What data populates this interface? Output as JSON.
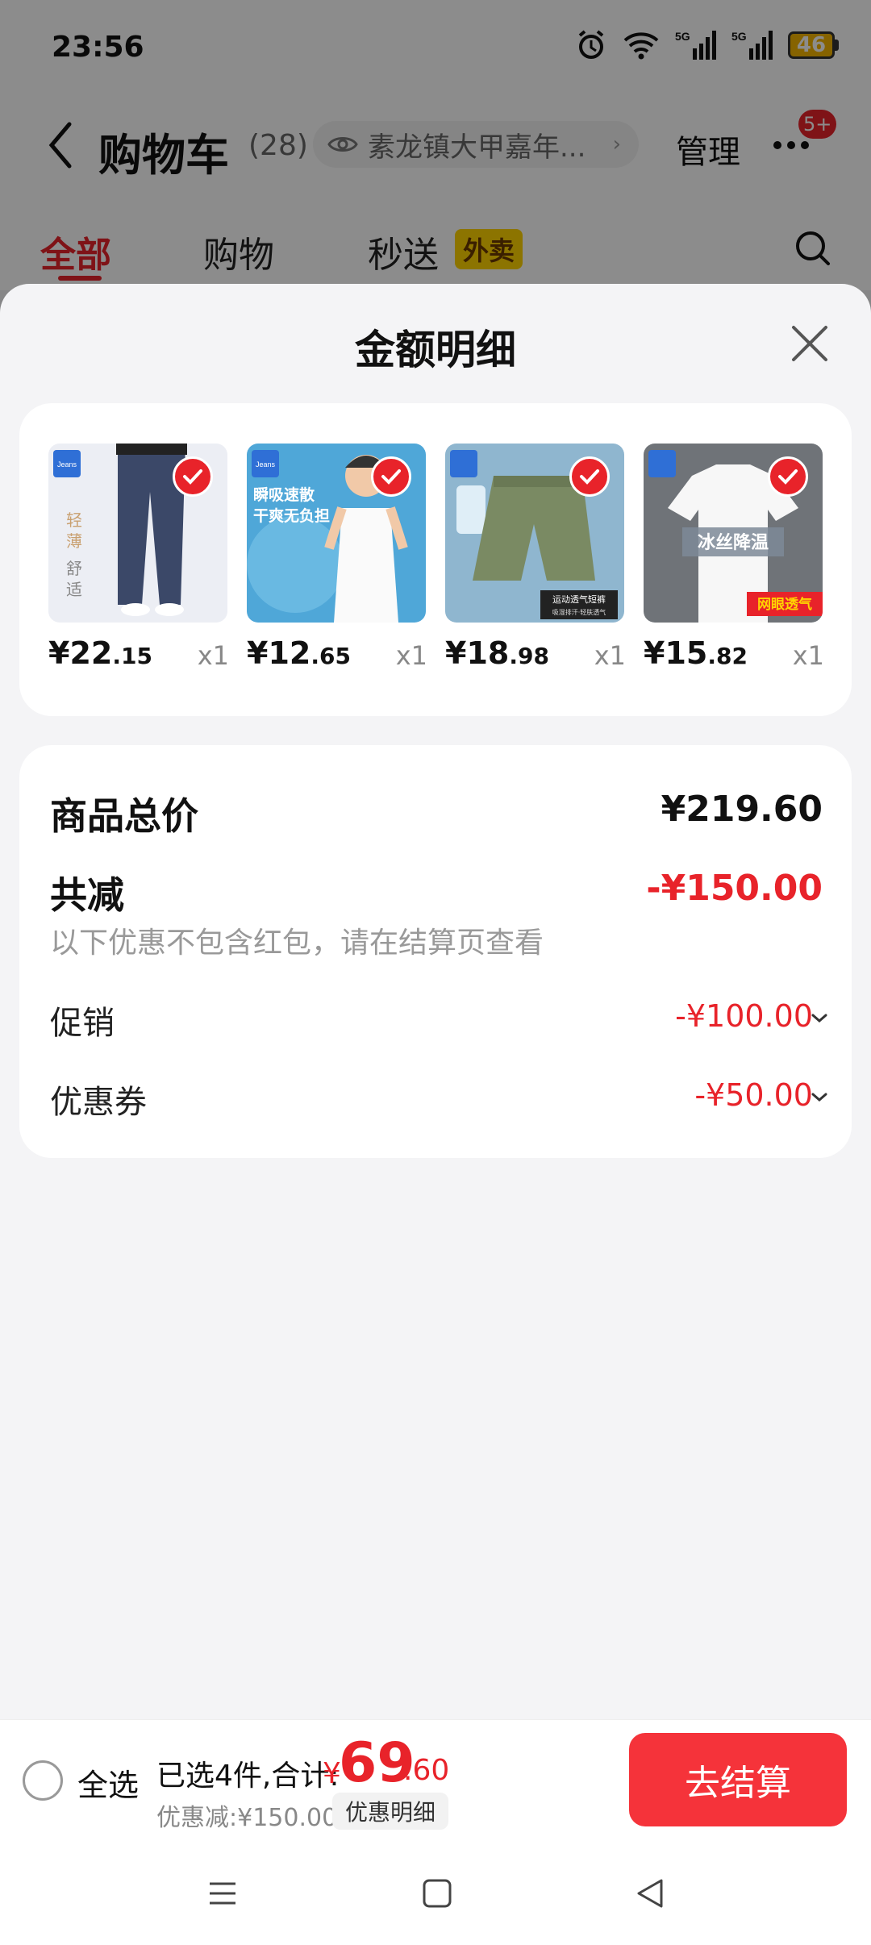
{
  "status_bar": {
    "time": "23:56",
    "battery": "46",
    "net1": "5G",
    "net2": "5G"
  },
  "header": {
    "title": "购物车",
    "count": "(28)",
    "address": "素龙镇大甲嘉年...",
    "manage": "管理",
    "badge": "5+"
  },
  "tabs": {
    "all": "全部",
    "shop": "购物",
    "fast": "秒送",
    "waimai": "外卖"
  },
  "sheet": {
    "title": "金额明细",
    "products": [
      {
        "price_int": "¥22",
        "price_dec": ".15",
        "qty": "x1",
        "image": "gray-pants",
        "labels": [
          "轻",
          "薄",
          "舒",
          "适"
        ]
      },
      {
        "price_int": "¥12",
        "price_dec": ".65",
        "qty": "x1",
        "image": "white-tank-top",
        "labels": [
          "瞬吸速散",
          "干爽无负担"
        ]
      },
      {
        "price_int": "¥18",
        "price_dec": ".98",
        "qty": "x1",
        "image": "green-shorts",
        "labels": [
          "运动透气短裤",
          "吸湿排汗·轻肤透气"
        ]
      },
      {
        "price_int": "¥15",
        "price_dec": ".82",
        "qty": "x1",
        "image": "white-tshirt",
        "labels": [
          "冰丝降温",
          "网眼透气"
        ]
      }
    ],
    "summary": {
      "total_label": "商品总价",
      "total_value": "¥219.60",
      "reduce_label": "共减",
      "reduce_value": "-¥150.00",
      "note": "以下优惠不包含红包，请在结算页查看",
      "promo_label": "促销",
      "promo_value": "-¥100.00",
      "coupon_label": "优惠券",
      "coupon_value": "-¥50.00"
    }
  },
  "bottom": {
    "select_all": "全选",
    "selected_text": "已选4件,合计:",
    "total_symbol": "¥",
    "total_int": "69",
    "total_dec": ".60",
    "discount_text": "优惠减:¥150.00",
    "discount_detail": "优惠明细",
    "checkout": "去结算"
  },
  "colors": {
    "accent": "#e8232a",
    "checkout": "#f5333a"
  }
}
